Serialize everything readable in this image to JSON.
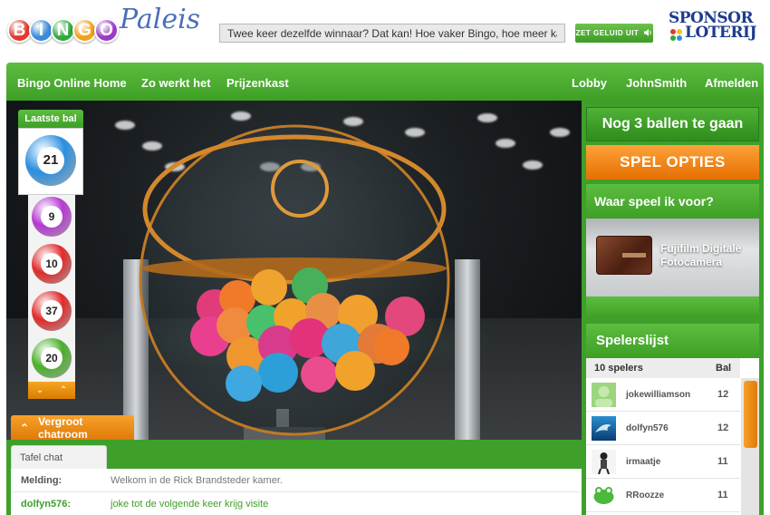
{
  "brand": {
    "logo_letters": [
      "B",
      "I",
      "N",
      "G",
      "O"
    ],
    "logo_colors": [
      "#e23a2f",
      "#3b8ad9",
      "#2faa3c",
      "#f0a11c",
      "#9b3bc7"
    ],
    "logo_suffix": "Paleis",
    "sponsor_line1": "SPONSOR",
    "sponsor_line2": "LOTERIJ"
  },
  "header": {
    "ticker_value": "Twee keer dezelfde winnaar? Dat kan! Hoe vaker Bingo, hoe meer kans!",
    "sound_button_label": "ZET GELUID UIT"
  },
  "nav": {
    "left": [
      "Bingo Online Home",
      "Zo werkt het",
      "Prijzenkast"
    ],
    "right": [
      "Lobby",
      "JohnSmith",
      "Afmelden"
    ]
  },
  "balls": {
    "last_label": "Laatste bal",
    "last": {
      "number": "21",
      "color": "#2a8fe0"
    },
    "history": [
      {
        "number": "9",
        "color": "#b63ad1"
      },
      {
        "number": "10",
        "color": "#e02b2b"
      },
      {
        "number": "37",
        "color": "#e02b2b"
      },
      {
        "number": "20",
        "color": "#4bb02a"
      }
    ],
    "scroll_down_icon": "chevron-down-icon",
    "scroll_up_icon": "chevron-up-icon"
  },
  "chat": {
    "toggle_label": "Vergroot chatroom",
    "tab_label": "Tafel chat",
    "messages": [
      {
        "who": "Melding:",
        "text": "Welkom in de Rick Brandsteder kamer.",
        "who_color": "#555555",
        "text_color": "#777777"
      },
      {
        "who": "dolfyn576:",
        "text": "joke tot de volgende keer krijg visite",
        "who_color": "#3ea02a",
        "text_color": "#3ea02a"
      }
    ]
  },
  "game": {
    "remaining_label": "Nog 3 ballen te gaan",
    "options_label": "SPEL OPTIES"
  },
  "prize": {
    "heading": "Waar speel ik voor?",
    "name": "Fujifilm Digitale Fotocamera"
  },
  "players": {
    "heading": "Spelerslijst",
    "count_label": "10 spelers",
    "column_label": "Bal",
    "rows": [
      {
        "name": "jokewilliamson",
        "balls": "12",
        "avatar": "green-placeholder-avatar"
      },
      {
        "name": "dolfyn576",
        "balls": "12",
        "avatar": "dolphin-avatar"
      },
      {
        "name": "irmaatje",
        "balls": "11",
        "avatar": "figure-avatar"
      },
      {
        "name": "RRoozze",
        "balls": "11",
        "avatar": "frog-avatar"
      }
    ]
  }
}
